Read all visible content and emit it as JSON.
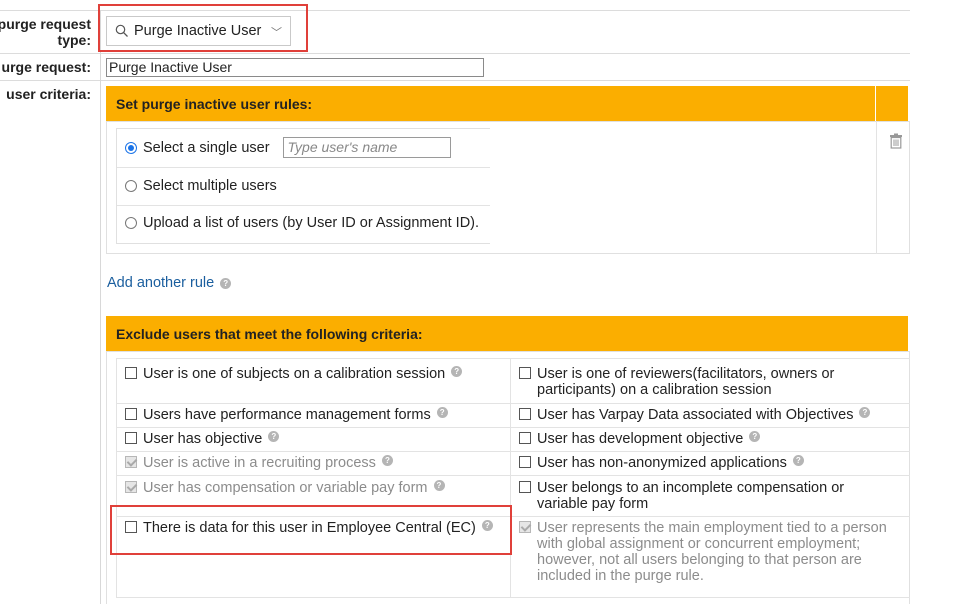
{
  "form": {
    "purge_type_label_1": "purge request",
    "purge_type_label_2": "type:",
    "purge_request_label": "urge request:",
    "user_criteria_label": "user criteria:",
    "purge_type_value": "Purge Inactive User",
    "purge_request_name": "Purge Inactive User"
  },
  "rules": {
    "header": "Set purge inactive user rules:",
    "options": [
      {
        "label": "Select a single user",
        "selected": true
      },
      {
        "label": "Select multiple users",
        "selected": false
      },
      {
        "label": "Upload a list of users (by User ID or Assignment ID).",
        "selected": false
      }
    ],
    "user_name_placeholder": "Type user's name",
    "add_another_rule": "Add another rule"
  },
  "exclude": {
    "header": "Exclude users that meet the following criteria:",
    "left": [
      {
        "label": "User is one of subjects on a calibration session",
        "checked": false,
        "disabled": false
      },
      {
        "label": "Users have performance management forms",
        "checked": false,
        "disabled": false
      },
      {
        "label": "User has objective",
        "checked": false,
        "disabled": false
      },
      {
        "label": "User is active in a recruiting process",
        "checked": true,
        "disabled": true
      },
      {
        "label": "User has compensation or variable pay form",
        "checked": true,
        "disabled": true
      },
      {
        "label": "There is data for this user in Employee Central (EC)",
        "checked": false,
        "disabled": false
      }
    ],
    "right": [
      {
        "label": "User is one of reviewers(facilitators, owners or participants) on a calibration session",
        "checked": false,
        "disabled": false
      },
      {
        "label": "User has Varpay Data associated with Objectives",
        "checked": false,
        "disabled": false
      },
      {
        "label": "User has development objective",
        "checked": false,
        "disabled": false
      },
      {
        "label": "User has non-anonymized applications",
        "checked": false,
        "disabled": false
      },
      {
        "label": "User belongs to an incomplete compensation or variable pay form",
        "checked": false,
        "disabled": false
      },
      {
        "label": "User represents the main employment tied to a person with global assignment or concurrent employment; however, not all users belonging to that person are included in the purge rule.",
        "checked": true,
        "disabled": true
      }
    ]
  },
  "colors": {
    "band": "#fbae00",
    "highlight": "#e0403a",
    "link": "#1a5e9e"
  }
}
